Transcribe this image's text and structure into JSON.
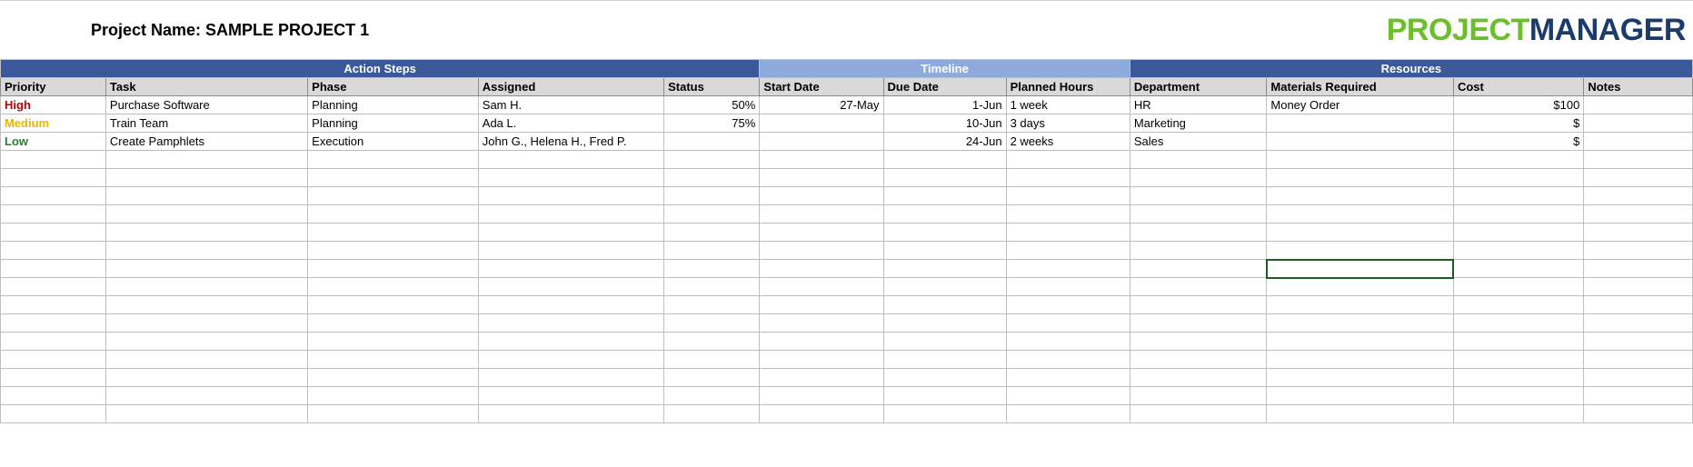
{
  "header": {
    "project_name": "Project Name: SAMPLE PROJECT 1",
    "logo_part1": "PROJECT",
    "logo_part2": "MANAGER"
  },
  "sections": {
    "action_steps": "Action Steps",
    "timeline": "Timeline",
    "resources": "Resources"
  },
  "columns": {
    "priority": "Priority",
    "task": "Task",
    "phase": "Phase",
    "assigned": "Assigned",
    "status": "Status",
    "start_date": "Start Date",
    "due_date": "Due Date",
    "planned_hours": "Planned Hours",
    "department": "Department",
    "materials_required": "Materials Required",
    "cost": "Cost",
    "notes": "Notes"
  },
  "rows": [
    {
      "priority": "High",
      "priority_class": "prio-high",
      "task": "Purchase Software",
      "phase": "Planning",
      "assigned": "Sam H.",
      "status": "50%",
      "start_date": "27-May",
      "due_date": "1-Jun",
      "planned_hours": "1 week",
      "department": "HR",
      "materials": "Money Order",
      "cost": "$100",
      "notes": ""
    },
    {
      "priority": "Medium",
      "priority_class": "prio-medium",
      "task": "Train Team",
      "phase": "Planning",
      "assigned": "Ada L.",
      "status": "75%",
      "start_date": "",
      "due_date": "10-Jun",
      "planned_hours": "3 days",
      "department": "Marketing",
      "materials": "",
      "cost": "$",
      "notes": ""
    },
    {
      "priority": "Low",
      "priority_class": "prio-low",
      "task": "Create Pamphlets",
      "phase": "Execution",
      "assigned": "John G., Helena H., Fred P.",
      "status": "",
      "start_date": "",
      "due_date": "24-Jun",
      "planned_hours": "2 weeks",
      "department": "Sales",
      "materials": "",
      "cost": "$",
      "notes": ""
    }
  ],
  "empty_row_count": 15,
  "selected_cell": {
    "row_index": 9,
    "col_index": 9
  }
}
